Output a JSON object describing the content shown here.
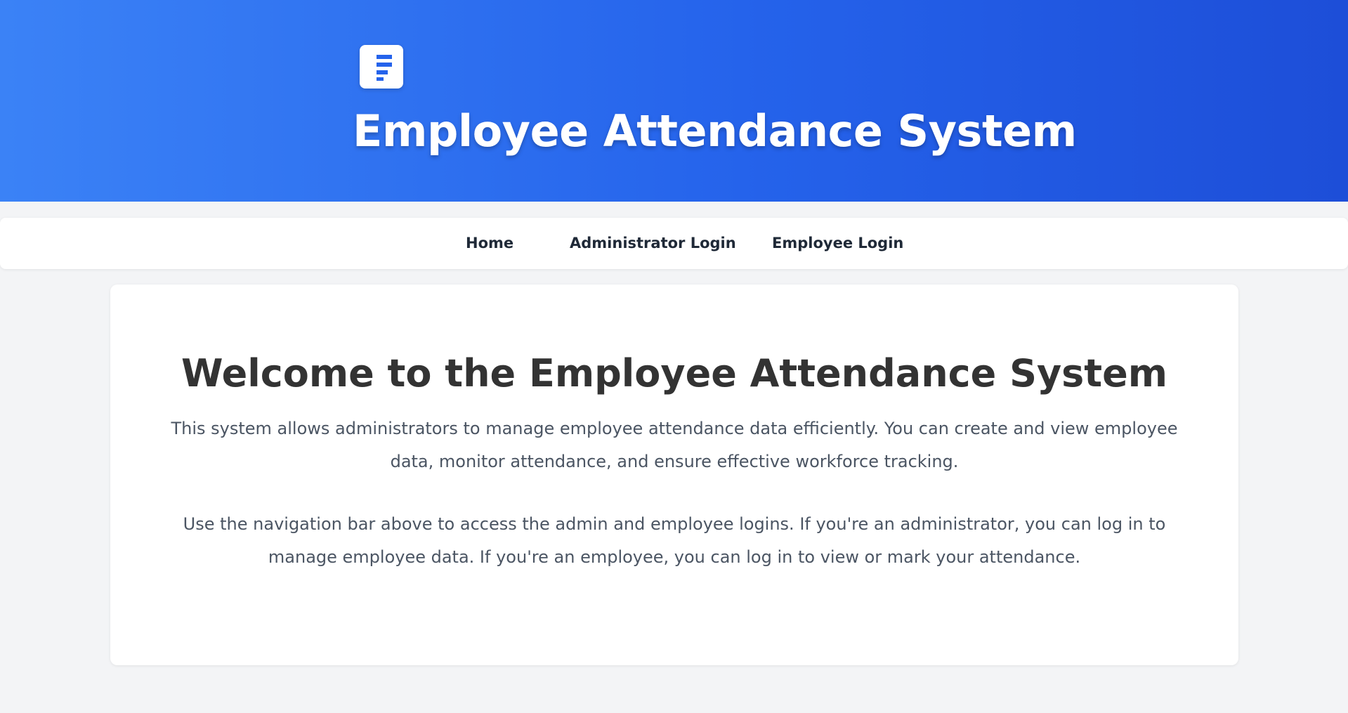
{
  "header": {
    "logo_icon": "document-icon",
    "title": "Employee Attendance System",
    "gradient_colors": [
      "#3b82f6",
      "#1d4ed8"
    ]
  },
  "nav": {
    "items": [
      {
        "label": "Home"
      },
      {
        "label": "Administrator Login"
      },
      {
        "label": "Employee Login"
      }
    ]
  },
  "main": {
    "title": "Welcome to the Employee Attendance System",
    "paragraphs": [
      "This system allows administrators to manage employee attendance data efficiently. You can create and view employee data, monitor attendance, and ensure effective workforce tracking.",
      "Use the navigation bar above to access the admin and employee logins. If you're an administrator, you can log in to manage employee data. If you're an employee, you can log in to view or mark your attendance."
    ]
  },
  "colors": {
    "background": "#f3f4f6",
    "accent": "#2563eb",
    "heading_text": "#333333",
    "body_text": "#4b5563"
  }
}
